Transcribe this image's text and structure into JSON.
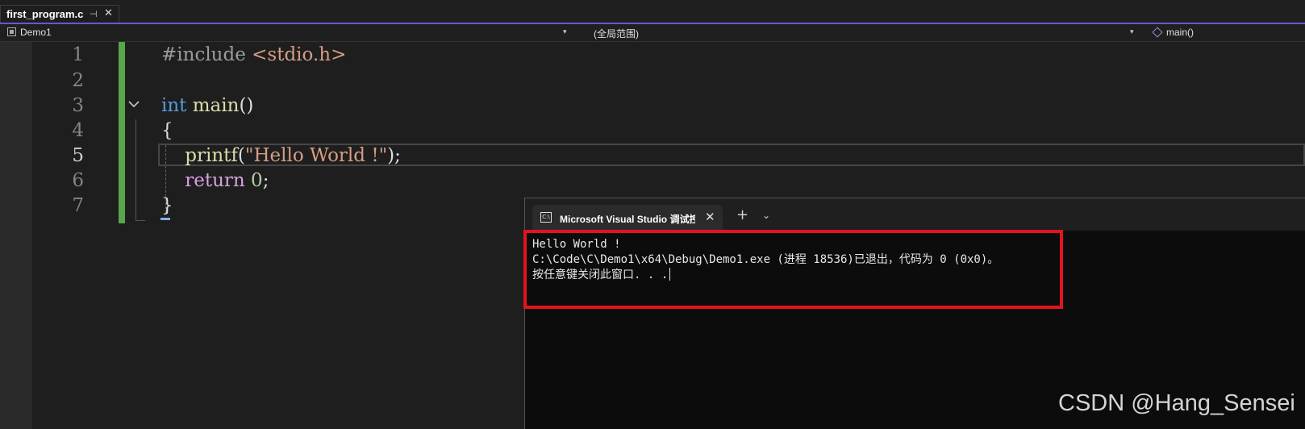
{
  "tab": {
    "filename": "first_program.c",
    "pin_glyph": "⊣",
    "close_glyph": "✕"
  },
  "navbar": {
    "project": "Demo1",
    "scope": "(全局范围)",
    "member": "main()"
  },
  "editor": {
    "line_numbers": [
      "1",
      "2",
      "3",
      "4",
      "5",
      "6",
      "7"
    ],
    "current_line": 5,
    "code": {
      "l1_directive": "#include",
      "l1_header": " <stdio.h>",
      "l3_type": "int",
      "l3_name": " main",
      "l3_parens": "()",
      "l4_brace": "{",
      "l5_indent": "    ",
      "l5_func": "printf",
      "l5_open": "(",
      "l5_string": "\"Hello World !\"",
      "l5_close": ");",
      "l6_indent": "    ",
      "l6_return": "return",
      "l6_space": " ",
      "l6_value": "0",
      "l6_semi": ";",
      "l7_brace": "}"
    }
  },
  "console": {
    "title": "Microsoft Visual Studio 调试控制台",
    "icon_text": "C:\\",
    "close_glyph": "✕",
    "plus_glyph": "+",
    "chevron_glyph": "⌄",
    "lines": [
      "Hello World !",
      "C:\\Code\\C\\Demo1\\x64\\Debug\\Demo1.exe (进程 18536)已退出，代码为 0 (0x0)。",
      "按任意键关闭此窗口. . ."
    ]
  },
  "annotation_color": "#e3141c",
  "watermark": "CSDN @Hang_Sensei"
}
